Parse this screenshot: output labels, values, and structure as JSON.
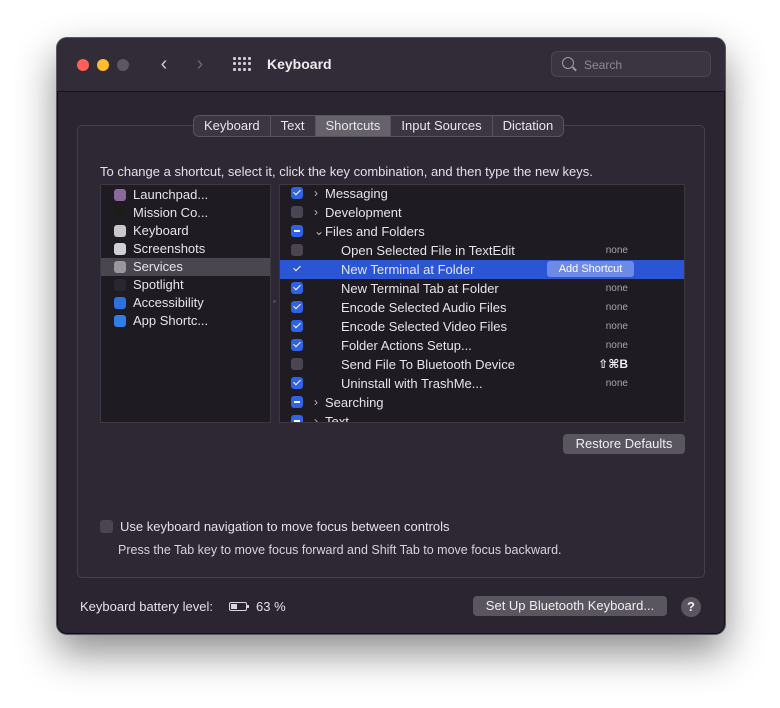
{
  "window": {
    "title": "Keyboard",
    "search_placeholder": "Search",
    "back_glyph": "‹",
    "forward_glyph": "›"
  },
  "tabs": [
    {
      "label": "Keyboard",
      "active": false
    },
    {
      "label": "Text",
      "active": false
    },
    {
      "label": "Shortcuts",
      "active": true
    },
    {
      "label": "Input Sources",
      "active": false
    },
    {
      "label": "Dictation",
      "active": false
    }
  ],
  "instructions": "To change a shortcut, select it, click the key combination, and then type the new keys.",
  "categories": [
    {
      "label": "Launchpad...",
      "icon": "launchpad-icon",
      "color": "#8a6a9a"
    },
    {
      "label": "Mission Co...",
      "icon": "mission-control-icon",
      "color": "#1c1c1c"
    },
    {
      "label": "Keyboard",
      "icon": "keyboard-icon",
      "color": "#c9c6cc"
    },
    {
      "label": "Screenshots",
      "icon": "screenshots-icon",
      "color": "#cfcfd4"
    },
    {
      "label": "Services",
      "icon": "gear-icon",
      "color": "#9a979e",
      "selected": true
    },
    {
      "label": "Spotlight",
      "icon": "spotlight-icon",
      "color": "#2a2630"
    },
    {
      "label": "Accessibility",
      "icon": "accessibility-icon",
      "color": "#2f6fe0"
    },
    {
      "label": "App Shortc...",
      "icon": "app-store-icon",
      "color": "#2f7de8"
    }
  ],
  "shortcuts": [
    {
      "label": "Messaging",
      "check": "on",
      "disclosure": "›",
      "indent": 0,
      "key": ""
    },
    {
      "label": "Development",
      "check": "off",
      "disclosure": "›",
      "indent": 0,
      "key": ""
    },
    {
      "label": "Files and Folders",
      "check": "mixed",
      "disclosure": "⌄",
      "indent": 0,
      "key": ""
    },
    {
      "label": "Open Selected File in TextEdit",
      "check": "off",
      "indent": 1,
      "key": "none"
    },
    {
      "label": "New Terminal at Folder",
      "check": "plain",
      "indent": 1,
      "key": "",
      "selected": true,
      "button": "Add Shortcut"
    },
    {
      "label": "New Terminal Tab at Folder",
      "check": "on",
      "indent": 1,
      "key": "none"
    },
    {
      "label": "Encode Selected Audio Files",
      "check": "on",
      "indent": 1,
      "key": "none"
    },
    {
      "label": "Encode Selected Video Files",
      "check": "on",
      "indent": 1,
      "key": "none"
    },
    {
      "label": "Folder Actions Setup...",
      "check": "on",
      "indent": 1,
      "key": "none"
    },
    {
      "label": "Send File To Bluetooth Device",
      "check": "off",
      "indent": 1,
      "key": "⇧⌘B"
    },
    {
      "label": "Uninstall with TrashMe...",
      "check": "on",
      "indent": 1,
      "key": "none"
    },
    {
      "label": "Searching",
      "check": "mixed",
      "disclosure": "›",
      "indent": 0,
      "key": ""
    },
    {
      "label": "Text",
      "check": "mixed",
      "disclosure": "›",
      "indent": 0,
      "key": ""
    }
  ],
  "restore_defaults": "Restore Defaults",
  "keyboard_nav": {
    "label": "Use keyboard navigation to move focus between controls",
    "description": "Press the Tab key to move focus forward and Shift Tab to move focus backward.",
    "checked": false
  },
  "battery": {
    "label": "Keyboard battery level:",
    "value": "63 %",
    "level_percent": 63
  },
  "setup_bluetooth": "Set Up Bluetooth Keyboard...",
  "help": "?"
}
